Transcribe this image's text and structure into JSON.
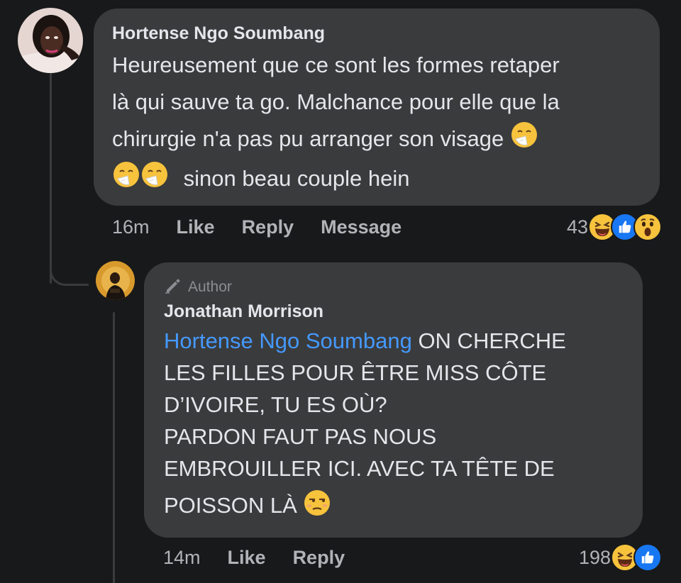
{
  "comments": [
    {
      "author": "Hortense Ngo Soumbang",
      "lines": [
        "Heureusement que ce sont les formes retaper",
        "là qui sauve ta go. Malchance pour elle que la",
        "chirurgie n'a pas pu arranger son visage",
        "sinon beau couple hein"
      ],
      "time": "16m",
      "actions": [
        "Like",
        "Reply",
        "Message"
      ],
      "reaction_count": "43",
      "reactions": [
        "haha",
        "like",
        "wow"
      ]
    },
    {
      "badge": "Author",
      "author": "Jonathan Morrison",
      "mention": "Hortense Ngo Soumbang",
      "lines": [
        " ON CHERCHE",
        "LES FILLES POUR ÊTRE MISS CÔTE",
        "D’IVOIRE, TU ES OÙ?",
        "PARDON FAUT PAS NOUS",
        "EMBROUILLER ICI. AVEC TA TÊTE DE",
        "POISSON LÀ"
      ],
      "time": "14m",
      "actions": [
        "Like",
        "Reply"
      ],
      "reaction_count": "198",
      "reactions": [
        "haha",
        "like"
      ]
    }
  ],
  "colors": {
    "background": "#18191a",
    "bubble": "#3a3b3c",
    "text": "#e4e6eb",
    "muted": "#b0b3b8",
    "mention": "#4599ff",
    "like_blue": "#1877f2",
    "emoji_yellow": "#f7c33d"
  },
  "icons": [
    "sneezing-face-emoji",
    "unamused-face-emoji",
    "haha-reaction-icon",
    "like-reaction-icon",
    "wow-reaction-icon",
    "pencil-author-icon"
  ]
}
